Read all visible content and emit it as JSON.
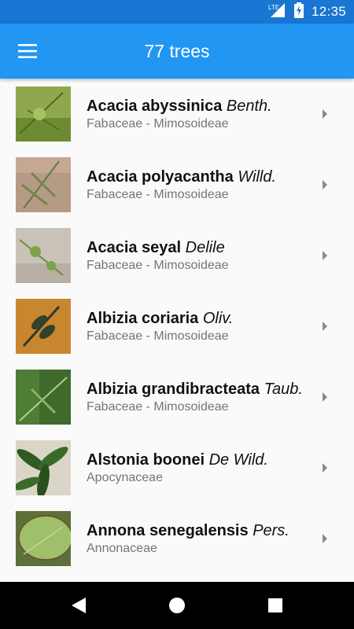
{
  "status_bar": {
    "network": "LTE",
    "time": "12:35"
  },
  "app_bar": {
    "title": "77 trees",
    "menu_icon": "hamburger-menu-icon"
  },
  "colors": {
    "status_bar": "#1976d2",
    "app_bar": "#2196f3",
    "secondary_text": "#757575"
  },
  "trees": [
    {
      "name": "Acacia abyssinica",
      "author": "Benth.",
      "family": "Fabaceae - Mimosoideae"
    },
    {
      "name": "Acacia polyacantha",
      "author": "Willd.",
      "family": "Fabaceae - Mimosoideae"
    },
    {
      "name": "Acacia seyal",
      "author": "Delile",
      "family": "Fabaceae - Mimosoideae"
    },
    {
      "name": "Albizia coriaria",
      "author": "Oliv.",
      "family": "Fabaceae - Mimosoideae"
    },
    {
      "name": "Albizia grandibracteata",
      "author": "Taub.",
      "family": "Fabaceae - Mimosoideae"
    },
    {
      "name": "Alstonia boonei",
      "author": "De Wild.",
      "family": "Apocynaceae"
    },
    {
      "name": "Annona senegalensis",
      "author": "Pers.",
      "family": "Annonaceae"
    }
  ],
  "nav_bar": {
    "back": "back-icon",
    "home": "home-icon",
    "recents": "recents-icon"
  }
}
